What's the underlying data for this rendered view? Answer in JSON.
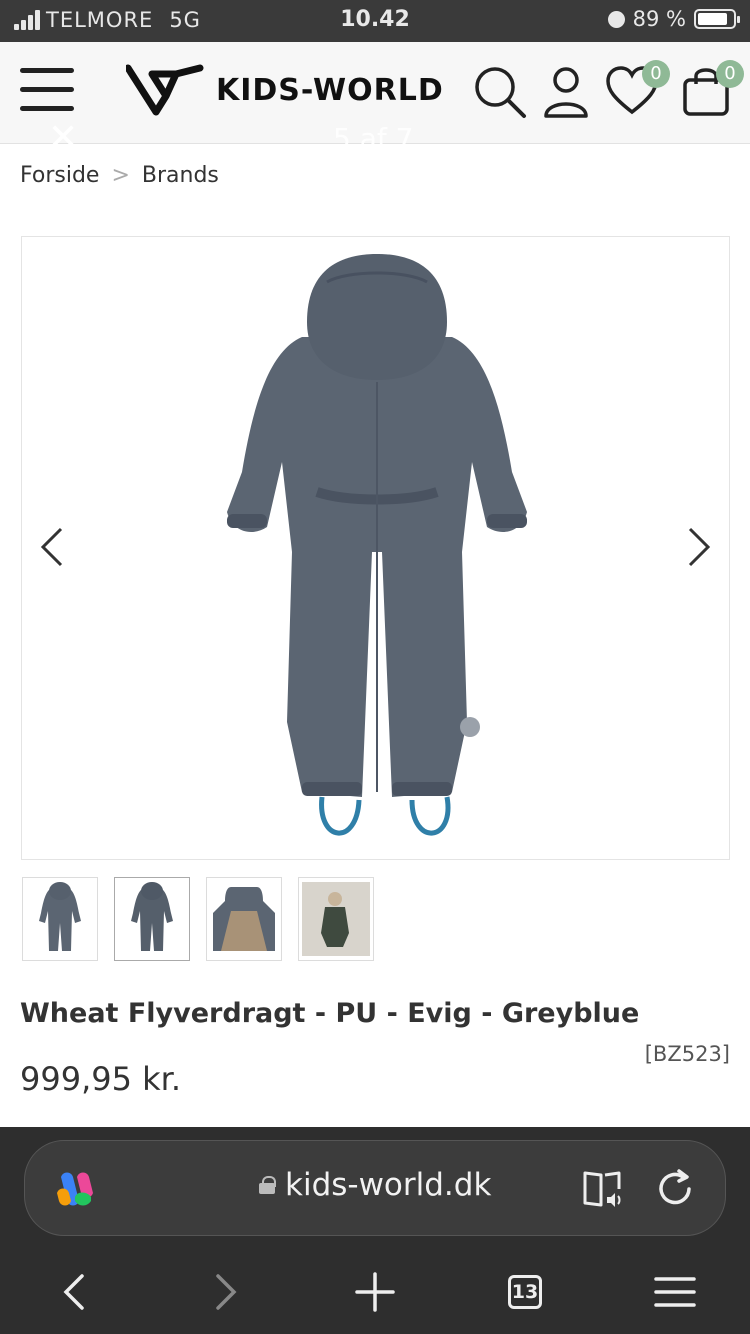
{
  "status_bar": {
    "carrier": "TELMORE",
    "network": "5G",
    "time": "10.42",
    "battery": "89 %"
  },
  "header": {
    "logo_text": "KIDS-WORLD",
    "wishlist_count": "0",
    "cart_count": "0",
    "overlay_close": "✕",
    "overlay_counter": "5 af 7"
  },
  "breadcrumb": {
    "items": [
      "Forside",
      "Brands"
    ],
    "separator": ">"
  },
  "product": {
    "title": "Wheat Flyverdragt - PU - Evig - Greyblue",
    "sku": "[BZ523]",
    "price": "999,95 kr.",
    "color_hex": "#5b6572",
    "strap_hex": "#2f7fa8"
  },
  "browser": {
    "url": "kids-world.dk",
    "tab_count": "13"
  }
}
